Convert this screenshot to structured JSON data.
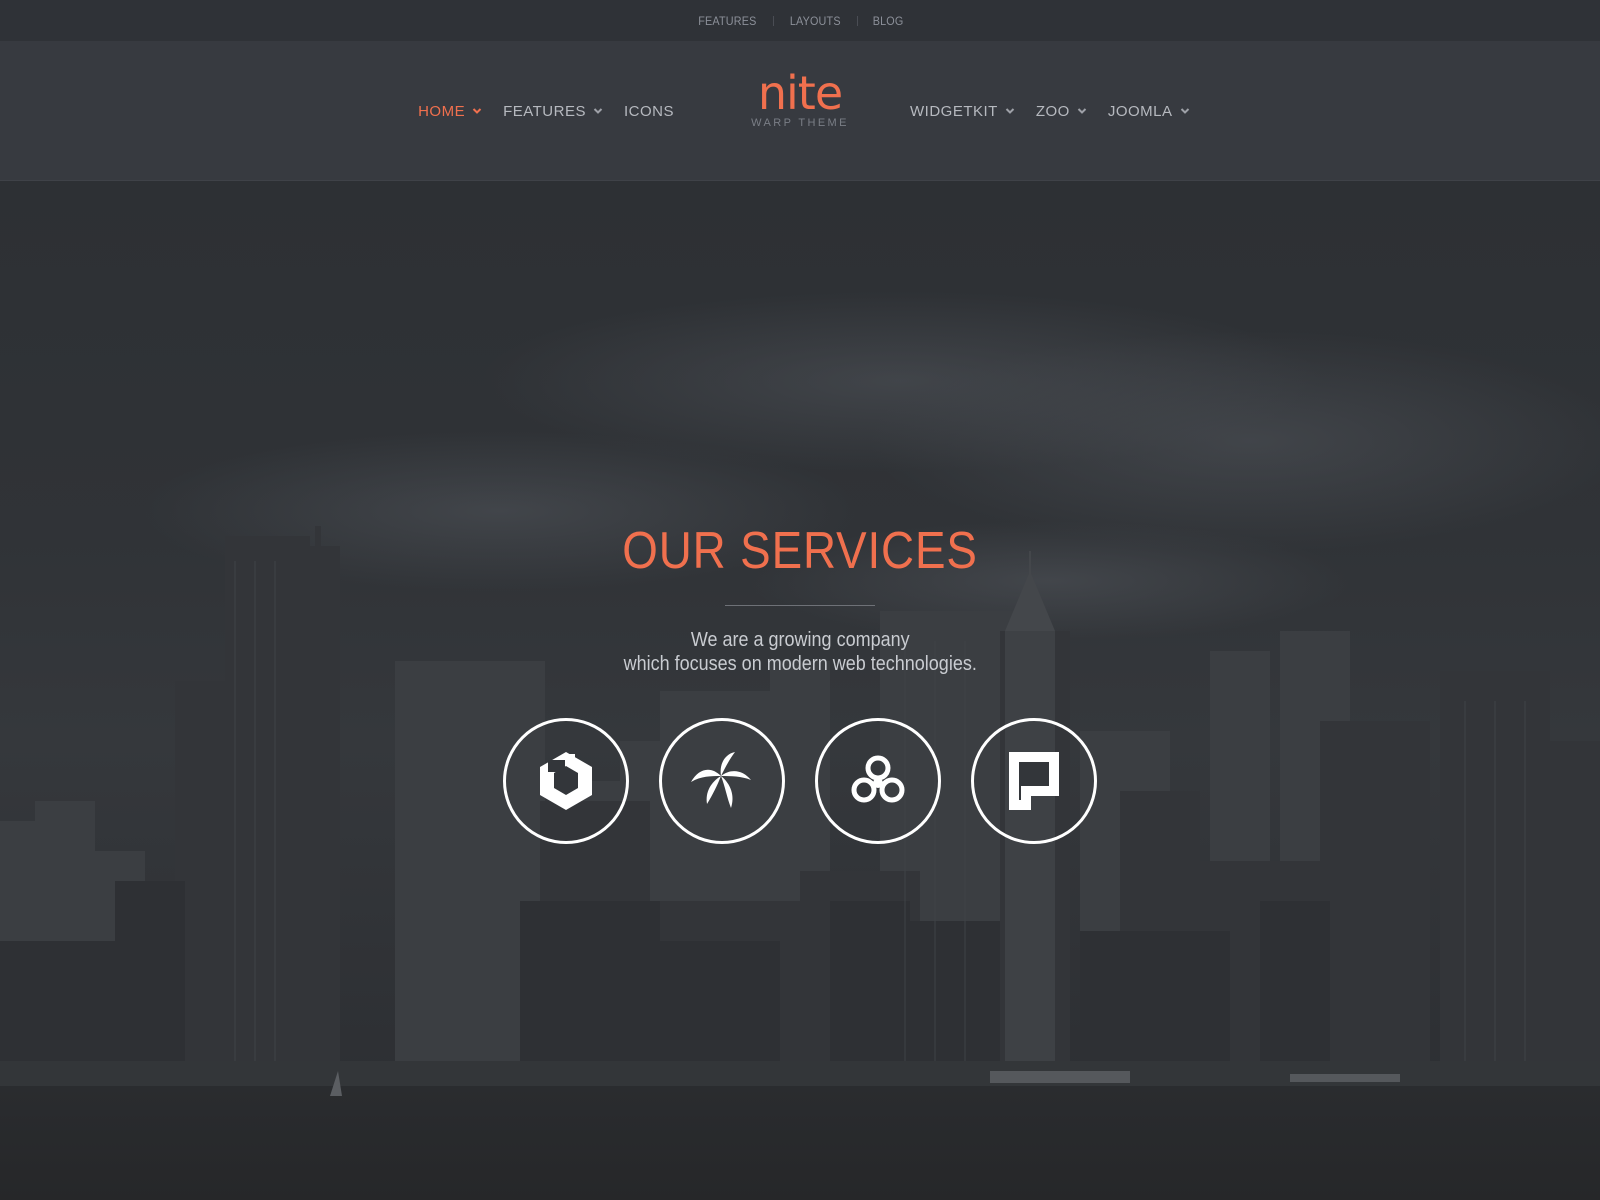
{
  "toolbar": {
    "links": [
      "FEATURES",
      "LAYOUTS",
      "BLOG"
    ]
  },
  "nav": {
    "left": [
      {
        "label": "HOME",
        "active": true,
        "has_dropdown": true
      },
      {
        "label": "FEATURES",
        "active": false,
        "has_dropdown": true
      },
      {
        "label": "ICONS",
        "active": false,
        "has_dropdown": false
      }
    ],
    "right": [
      {
        "label": "WIDGETKIT",
        "has_dropdown": true
      },
      {
        "label": "ZOO",
        "has_dropdown": true
      },
      {
        "label": "JOOMLA",
        "has_dropdown": true
      }
    ]
  },
  "logo": {
    "name": "nite",
    "subtitle": "WARP THEME"
  },
  "hero": {
    "title": "OUR SERVICES",
    "text_line1": "We are a growing company",
    "text_line2": "which focuses on modern web technologies.",
    "services": [
      {
        "icon": "uikit-icon"
      },
      {
        "icon": "palm-leaf-icon"
      },
      {
        "icon": "three-circles-icon"
      },
      {
        "icon": "pagekit-icon"
      }
    ]
  },
  "colors": {
    "accent": "#f0704e",
    "toolbar_bg": "#2f3237",
    "header_bg": "#373a40",
    "hero_bg": "#2d3034",
    "nav_text": "#b6b9bf"
  }
}
